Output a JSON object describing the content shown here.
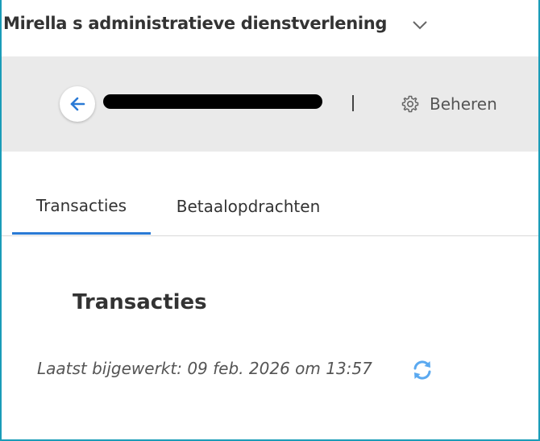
{
  "org_selector": {
    "name": "Mirella s administratieve dienstverlening",
    "chevron_icon": "chevron-down-icon"
  },
  "header": {
    "back_icon": "arrow-left-icon",
    "account_name_redacted": true,
    "manage_icon": "gear-icon",
    "manage_label": "Beheren"
  },
  "tabs": [
    {
      "label": "Transacties",
      "active": true
    },
    {
      "label": "Betaalopdrachten",
      "active": false
    }
  ],
  "main": {
    "title": "Transacties",
    "last_updated": "Laatst bijgewerkt: 09 feb. 2026 om 13:57",
    "refresh_icon": "refresh-icon"
  },
  "colors": {
    "accent": "#2a7ad5",
    "refresh": "#5aa9f0",
    "header_background": "#eaeaea",
    "frame_border": "#1a9cb8"
  }
}
